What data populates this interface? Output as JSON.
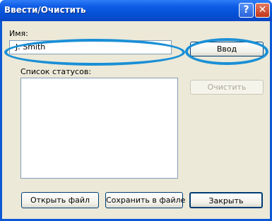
{
  "window": {
    "title": "Ввести/Очистить",
    "help_glyph": "?",
    "close_glyph": "✕"
  },
  "form": {
    "name_label": "Имя:",
    "name_value": "J. Smith",
    "enter_label": "Ввод",
    "status_list_label": "Список статусов:",
    "status_items": [],
    "clear_label": "Очистить",
    "open_file_label": "Открыть файл",
    "save_file_label": "Сохранить в файле",
    "close_label": "Закрыть"
  },
  "colors": {
    "titlebar": "#0a57d6",
    "highlight": "#1a8fd6",
    "dialog_bg": "#ece9d8"
  }
}
